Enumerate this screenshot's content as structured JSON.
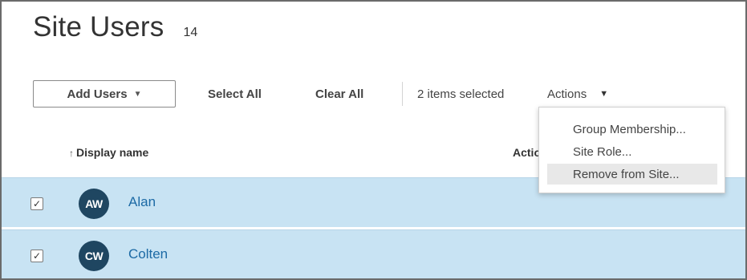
{
  "header": {
    "title": "Site Users",
    "count": "14"
  },
  "toolbar": {
    "add_users_label": "Add Users",
    "add_users_caret": "▼",
    "select_all_label": "Select All",
    "clear_all_label": "Clear All",
    "selection_status": "2 items selected",
    "actions_label": "Actions",
    "actions_caret": "▼"
  },
  "columns": {
    "sort_indicator": "↑",
    "display_name": "Display name",
    "actions": "Actions"
  },
  "rows": [
    {
      "checked": true,
      "check_glyph": "✓",
      "initials": "AW",
      "name": "Alan"
    },
    {
      "checked": true,
      "check_glyph": "✓",
      "initials": "CW",
      "name": "Colten"
    }
  ],
  "actions_menu": {
    "items": [
      {
        "label": "Group Membership..."
      },
      {
        "label": "Site Role..."
      },
      {
        "label": "Remove from Site..."
      }
    ],
    "highlighted_index": 2
  },
  "colors": {
    "selected_row": "#c8e3f3",
    "avatar": "#1f4661",
    "link": "#1c6aa5"
  },
  "icons": {
    "sort": "arrow-up-icon",
    "caret": "caret-down-icon",
    "check": "checkmark-icon"
  }
}
